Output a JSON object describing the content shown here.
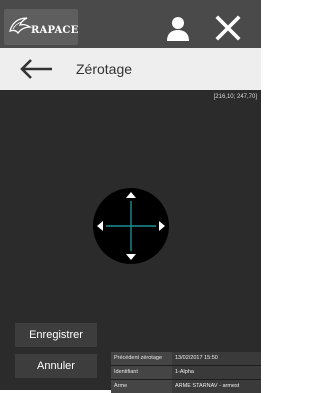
{
  "app": {
    "logo_text": "RAPACE"
  },
  "header": {
    "title": "Zérotage"
  },
  "viewport": {
    "coordinates": "[216,10; 247,70]"
  },
  "actions": {
    "save_label": "Enregistrer",
    "cancel_label": "Annuler"
  },
  "info": {
    "rows": [
      {
        "label": "Précédent zérotage",
        "value": "13/02/2017 15:50"
      },
      {
        "label": "Identifiant",
        "value": "1-Alpha"
      },
      {
        "label": "Arme",
        "value": "ARME STARNAV - armest"
      }
    ]
  },
  "colors": {
    "topbar": "#4a4a4a",
    "accent": "#2e6cb7",
    "header": "#eeeeee",
    "viewport": "#2b2b2b",
    "crosshair": "#1a8f8f"
  },
  "icons": {
    "user": "user-icon",
    "close": "close-icon",
    "back": "arrow-left-icon",
    "joystick": "direction-pad-icon"
  }
}
